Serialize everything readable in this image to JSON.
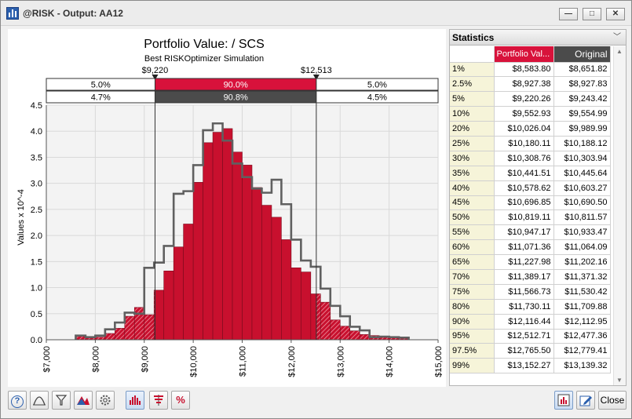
{
  "window": {
    "title": "@RISK - Output: AA12",
    "minimize": "—",
    "maximize": "□",
    "close": "✕"
  },
  "chart_data": {
    "type": "bar",
    "title": "Portfolio Value: / SCS",
    "subtitle": "Best RISKOptimizer Simulation",
    "ylabel": "Values x 10^-4",
    "xlim": [
      7000,
      15000
    ],
    "ylim": [
      0,
      4.5
    ],
    "xticks": [
      7000,
      8000,
      9000,
      10000,
      11000,
      12000,
      13000,
      14000,
      15000
    ],
    "xtick_labels": [
      "$7,000",
      "$8,000",
      "$9,000",
      "$10,000",
      "$11,000",
      "$12,000",
      "$13,000",
      "$14,000",
      "$15,000"
    ],
    "yticks": [
      0,
      0.5,
      1.0,
      1.5,
      2.0,
      2.5,
      3.0,
      3.5,
      4.0,
      4.5
    ],
    "ytick_labels": [
      "0.0",
      "0.5",
      "1.0",
      "1.5",
      "2.0",
      "2.5",
      "3.0",
      "3.5",
      "4.0",
      "4.5"
    ],
    "grid": true,
    "bin_width": 200,
    "series": [
      {
        "name": "Portfolio Value",
        "color": "#c8102e",
        "render": "bars",
        "x": [
          7600,
          7800,
          8000,
          8200,
          8400,
          8600,
          8800,
          9000,
          9200,
          9400,
          9600,
          9800,
          10000,
          10200,
          10400,
          10600,
          10800,
          11000,
          11200,
          11400,
          11600,
          11800,
          12000,
          12200,
          12400,
          12600,
          12800,
          13000,
          13200,
          13400,
          13600,
          13800,
          14000,
          14200
        ],
        "values": [
          0.07,
          0.06,
          0.05,
          0.12,
          0.22,
          0.45,
          0.62,
          0.48,
          0.95,
          1.32,
          1.78,
          2.22,
          3.02,
          3.78,
          3.98,
          4.05,
          3.6,
          3.35,
          2.92,
          2.58,
          2.35,
          1.92,
          1.38,
          1.3,
          0.88,
          0.72,
          0.38,
          0.26,
          0.17,
          0.1,
          0.08,
          0.06,
          0.06,
          0.04
        ]
      },
      {
        "name": "Original",
        "color": "#606060",
        "render": "step",
        "x": [
          7600,
          7800,
          8000,
          8200,
          8400,
          8600,
          8800,
          9000,
          9200,
          9400,
          9600,
          9800,
          10000,
          10200,
          10400,
          10600,
          10800,
          11000,
          11200,
          11400,
          11600,
          11800,
          12000,
          12200,
          12400,
          12600,
          12800,
          13000,
          13200,
          13400,
          13600,
          13800,
          14000,
          14200
        ],
        "values": [
          0.08,
          0.05,
          0.08,
          0.2,
          0.33,
          0.52,
          0.5,
          1.38,
          1.48,
          1.8,
          2.8,
          2.85,
          3.35,
          4.02,
          4.15,
          3.82,
          3.38,
          3.12,
          2.9,
          2.82,
          3.07,
          2.6,
          1.92,
          1.52,
          1.4,
          0.98,
          0.65,
          0.45,
          0.25,
          0.18,
          0.05,
          0.06,
          0.05,
          0.04
        ]
      }
    ],
    "delimiters": {
      "left": 9220,
      "right": 12513,
      "left_label": "$9,220",
      "right_label": "$12,513"
    },
    "bands": {
      "top": [
        "5.0%",
        "90.0%",
        "5.0%"
      ],
      "bottom": [
        "4.7%",
        "90.8%",
        "4.5%"
      ]
    }
  },
  "statistics": {
    "title": "Statistics",
    "col1": "Portfolio Val...",
    "col2": "Original",
    "rows": [
      [
        "1%",
        "$8,583.80",
        "$8,651.82"
      ],
      [
        "2.5%",
        "$8,927.38",
        "$8,927.83"
      ],
      [
        "5%",
        "$9,220.26",
        "$9,243.42"
      ],
      [
        "10%",
        "$9,552.93",
        "$9,554.99"
      ],
      [
        "20%",
        "$10,026.04",
        "$9,989.99"
      ],
      [
        "25%",
        "$10,180.11",
        "$10,188.12"
      ],
      [
        "30%",
        "$10,308.76",
        "$10,303.94"
      ],
      [
        "35%",
        "$10,441.51",
        "$10,445.64"
      ],
      [
        "40%",
        "$10,578.62",
        "$10,603.27"
      ],
      [
        "45%",
        "$10,696.85",
        "$10,690.50"
      ],
      [
        "50%",
        "$10,819.11",
        "$10,811.57"
      ],
      [
        "55%",
        "$10,947.17",
        "$10,933.47"
      ],
      [
        "60%",
        "$11,071.36",
        "$11,064.09"
      ],
      [
        "65%",
        "$11,227.98",
        "$11,202.16"
      ],
      [
        "70%",
        "$11,389.17",
        "$11,371.32"
      ],
      [
        "75%",
        "$11,566.73",
        "$11,530.42"
      ],
      [
        "80%",
        "$11,730.11",
        "$11,709.88"
      ],
      [
        "90%",
        "$12,116.44",
        "$12,112.95"
      ],
      [
        "95%",
        "$12,512.71",
        "$12,477.36"
      ],
      [
        "97.5%",
        "$12,765.50",
        "$12,779.41"
      ],
      [
        "99%",
        "$13,152.27",
        "$13,139.32"
      ]
    ]
  },
  "toolbar": {
    "close_label": "Close"
  },
  "icons": {
    "help": "?",
    "fit": "⚠",
    "filter": "▽",
    "graph_type": "▲",
    "settings": "⚙",
    "histogram": "📊",
    "tornado": "⏚",
    "percent": "%",
    "report": "📋",
    "edit": "✎"
  }
}
